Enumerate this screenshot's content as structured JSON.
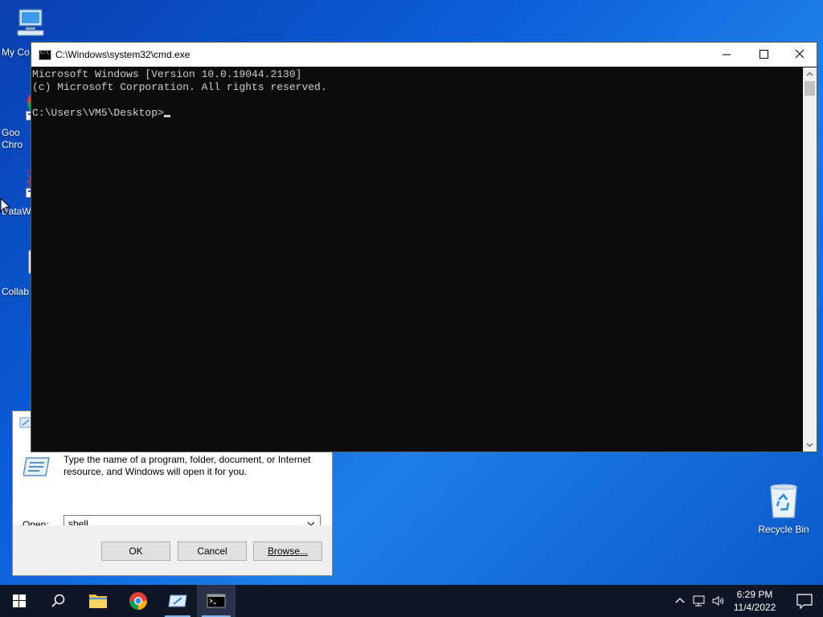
{
  "desktop": {
    "icons": [
      {
        "label": "My Co",
        "name": "my-computer"
      },
      {
        "label": "Goo\nChro",
        "name": "google-chrome"
      },
      {
        "label": "DataW",
        "name": "datawrapper"
      },
      {
        "label": "Collab",
        "name": "collab"
      }
    ],
    "recycle_bin": {
      "label": "Recycle Bin"
    }
  },
  "run_dialog": {
    "description": "Type the name of a program, folder, document, or Internet resource, and Windows will open it for you.",
    "open_label": "Open:",
    "open_value": "shell",
    "ok_label": "OK",
    "cancel_label": "Cancel",
    "browse_label": "Browse..."
  },
  "cmd": {
    "title": "C:\\Windows\\system32\\cmd.exe",
    "lines": [
      "Microsoft Windows [Version 10.0.19044.2130]",
      "(c) Microsoft Corporation. All rights reserved.",
      "",
      "C:\\Users\\VM5\\Desktop>"
    ]
  },
  "taskbar": {
    "time": "6:29 PM",
    "date": "11/4/2022",
    "items": [
      "start",
      "search",
      "file-explorer",
      "chrome",
      "run",
      "cmd"
    ]
  },
  "colors": {
    "console_bg": "#0c0c0c",
    "console_fg": "#cccccc",
    "taskbar_bg": "#101626",
    "accent": "#7eb4ea"
  }
}
